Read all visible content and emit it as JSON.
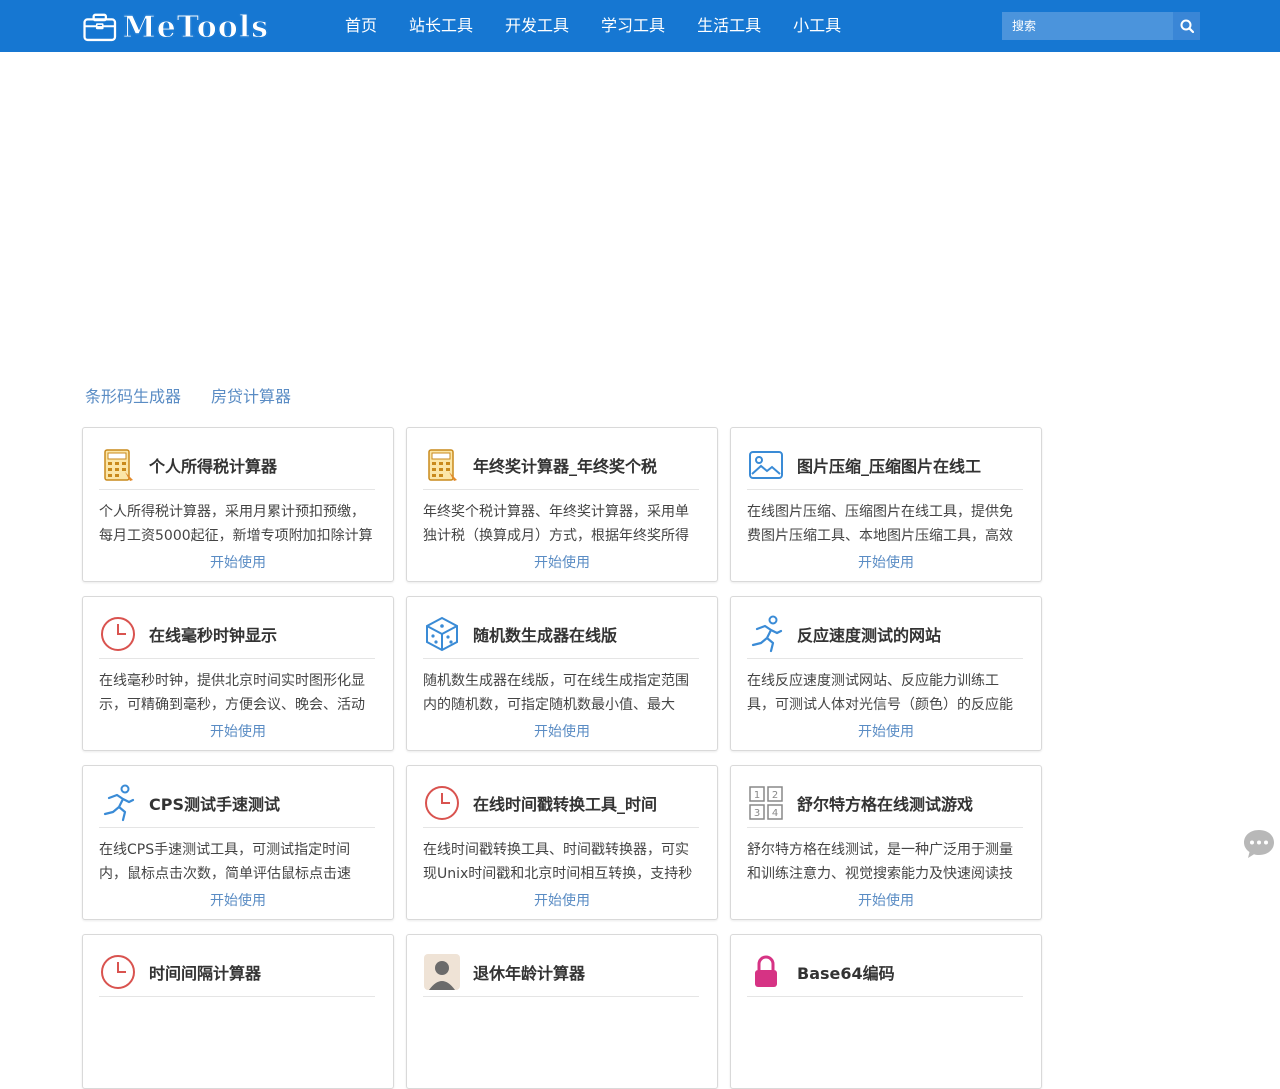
{
  "header": {
    "logo_text": "MeTools",
    "nav": [
      "首页",
      "站长工具",
      "开发工具",
      "学习工具",
      "生活工具",
      "小工具"
    ],
    "search_placeholder": "搜索"
  },
  "quick_links": [
    "条形码生成器",
    "房贷计算器"
  ],
  "colors": {
    "brand": "#1677d2",
    "link": "#5a8cc4"
  },
  "cards": [
    {
      "title": "个人所得税计算器",
      "icon": "calculator-icon",
      "desc": "个人所得税计算器，采用月累计预扣预缴，每月工资5000起征，新增专项附加扣除计算",
      "action": "开始使用"
    },
    {
      "title": "年终奖计算器_年终奖个税",
      "icon": "calculator-icon",
      "desc": "年终奖个税计算器、年终奖计算器，采用单独计税（换算成月）方式，根据年终奖所得",
      "action": "开始使用"
    },
    {
      "title": "图片压缩_压缩图片在线工",
      "icon": "image-icon",
      "desc": "在线图片压缩、压缩图片在线工具，提供免费图片压缩工具、本地图片压缩工具，高效",
      "action": "开始使用"
    },
    {
      "title": "在线毫秒时钟显示",
      "icon": "clock-icon",
      "desc": "在线毫秒时钟，提供北京时间实时图形化显示，可精确到毫秒，方便会议、晚会、活动",
      "action": "开始使用"
    },
    {
      "title": "随机数生成器在线版",
      "icon": "dice-icon",
      "desc": "随机数生成器在线版，可在线生成指定范围内的随机数，可指定随机数最小值、最大",
      "action": "开始使用"
    },
    {
      "title": "反应速度测试的网站",
      "icon": "runner-icon",
      "desc": "在线反应速度测试网站、反应能力训练工具，可测试人体对光信号（颜色）的反应能",
      "action": "开始使用"
    },
    {
      "title": "CPS测试手速测试",
      "icon": "runner-icon",
      "desc": "在线CPS手速测试工具，可测试指定时间内，鼠标点击次数，简单评估鼠标点击速",
      "action": "开始使用"
    },
    {
      "title": "在线时间戳转换工具_时间",
      "icon": "clock-icon",
      "desc": "在线时间戳转换工具、时间戳转换器，可实现Unix时间戳和北京时间相互转换，支持秒",
      "action": "开始使用"
    },
    {
      "title": "舒尔特方格在线测试游戏",
      "icon": "grid-numbers-icon",
      "desc": "舒尔特方格在线测试，是一种广泛用于测量和训练注意力、视觉搜索能力及快速阅读技",
      "action": "开始使用"
    },
    {
      "title": "时间间隔计算器",
      "icon": "clock-icon",
      "desc": "",
      "action": ""
    },
    {
      "title": "退休年龄计算器",
      "icon": "avatar-icon",
      "desc": "",
      "action": ""
    },
    {
      "title": "Base64编码",
      "icon": "lock-icon",
      "desc": "",
      "action": ""
    }
  ]
}
